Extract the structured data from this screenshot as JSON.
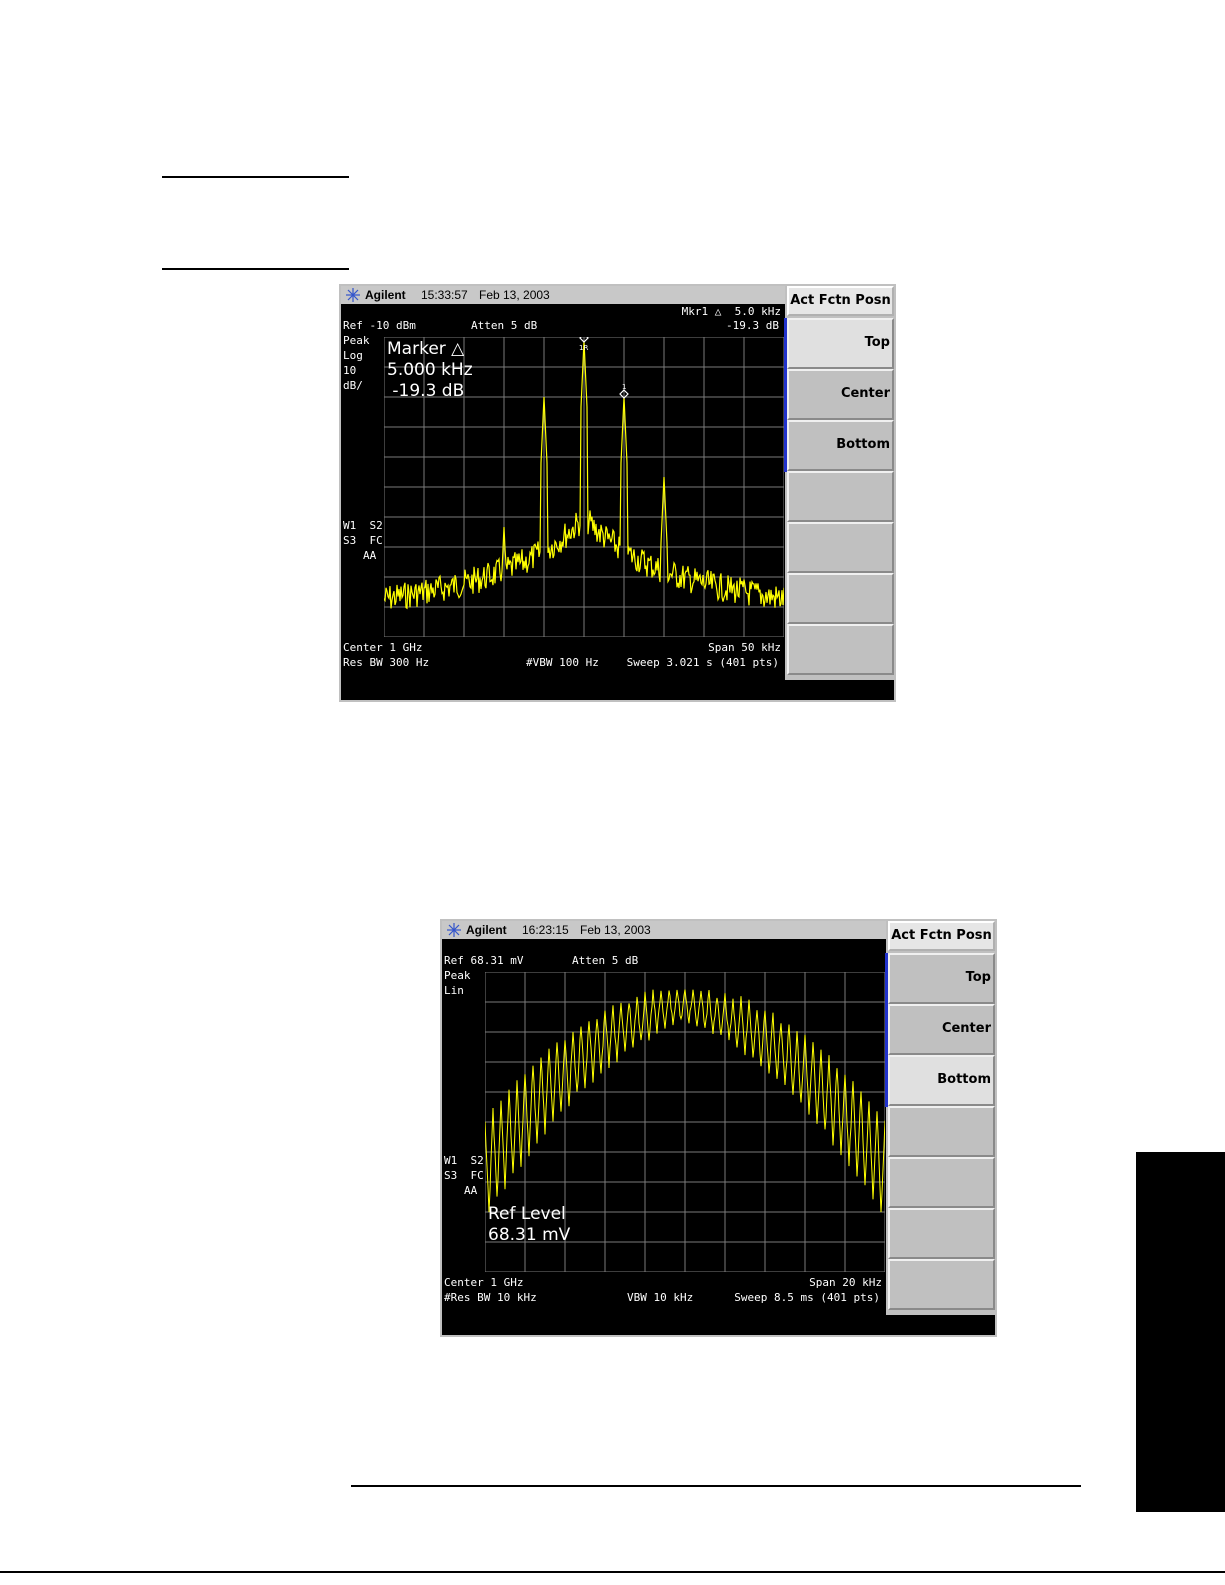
{
  "screens": [
    {
      "brand": "Agilent",
      "time": "15:33:57",
      "date": "Feb 13, 2003",
      "marker_readout": [
        "Mkr1 △  5.0 kHz",
        "-19.3 dB"
      ],
      "ref_line": "Ref -10 dBm",
      "atten": "Atten 5 dB",
      "scale_lines": [
        "Peak",
        "Log",
        "10",
        "dB/"
      ],
      "status_lines": [
        "W1  S2",
        "S3  FC",
        "AA"
      ],
      "active_function": [
        "Marker △",
        "5.000 kHz",
        " -19.3 dB"
      ],
      "marker_labels": [
        "1R",
        "1"
      ],
      "center": "Center 1 GHz",
      "span": "Span 50 kHz",
      "res_bw": "Res BW 300 Hz",
      "vbw": "#VBW 100 Hz",
      "sweep": "Sweep 3.021 s (401 pts)",
      "softkey_title": "Act Fctn Posn",
      "softkeys": [
        {
          "label": "Top",
          "selected": true
        },
        {
          "label": "Center",
          "selected": false
        },
        {
          "label": "Bottom",
          "selected": false
        },
        {
          "label": "",
          "selected": false
        },
        {
          "label": "",
          "selected": false
        },
        {
          "label": "",
          "selected": false
        },
        {
          "label": "",
          "selected": false
        }
      ],
      "trace_color": "#ffff00"
    },
    {
      "brand": "Agilent",
      "time": "16:23:15",
      "date": "Feb 13, 2003",
      "ref_line": "Ref 68.31 mV",
      "atten": "Atten 5 dB",
      "scale_lines": [
        "Peak",
        "Lin"
      ],
      "status_lines": [
        "W1  S2",
        "S3  FC",
        "AA"
      ],
      "active_function": [
        "Ref Level",
        "68.31 mV"
      ],
      "center": "Center 1 GHz",
      "span": "Span 20 kHz",
      "res_bw": "#Res BW 10 kHz",
      "vbw": "VBW 10 kHz",
      "sweep": "Sweep 8.5 ms (401 pts)",
      "softkey_title": "Act Fctn Posn",
      "softkeys": [
        {
          "label": "Top",
          "selected": false
        },
        {
          "label": "Center",
          "selected": false
        },
        {
          "label": "Bottom",
          "selected": true
        },
        {
          "label": "",
          "selected": false
        },
        {
          "label": "",
          "selected": false
        },
        {
          "label": "",
          "selected": false
        },
        {
          "label": "",
          "selected": false
        }
      ],
      "trace_color": "#ffff00"
    }
  ]
}
